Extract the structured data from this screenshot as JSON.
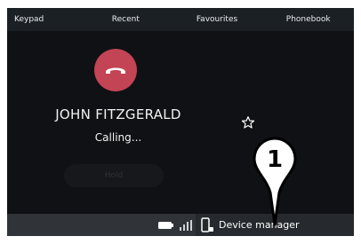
{
  "tabs": [
    {
      "label": "Keypad"
    },
    {
      "label": "Recent"
    },
    {
      "label": "Favourites"
    },
    {
      "label": "Phonebook"
    }
  ],
  "call": {
    "caller_name": "JOHN FITZGERALD",
    "status": "Calling...",
    "hold_label": "Hold",
    "end_call_icon": "phone-hangup-icon",
    "favourite_icon": "star-outline-icon"
  },
  "status_bar": {
    "device_manager_label": "Device manager",
    "battery_icon": "battery-icon",
    "signal_icon": "signal-bars-icon",
    "device_icon": "phone-device-icon"
  },
  "callout": {
    "number": "1"
  },
  "colors": {
    "end_call": "#c24455",
    "tab_bar": "#1b2024",
    "background": "#101114"
  }
}
